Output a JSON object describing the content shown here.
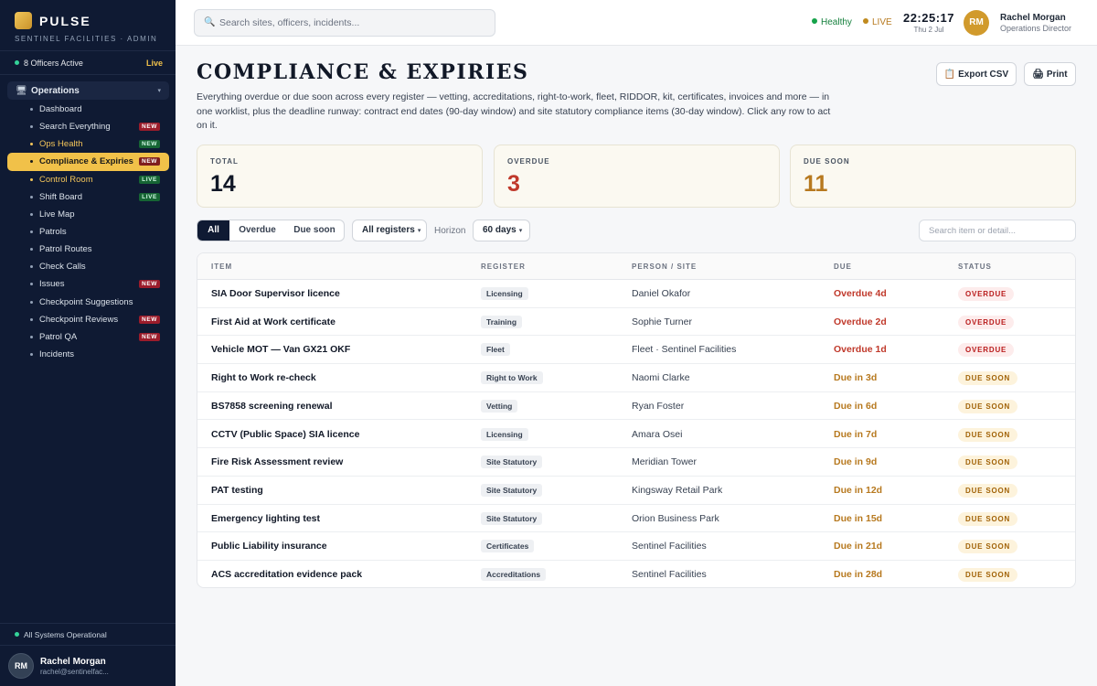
{
  "sidebar": {
    "brand_name": "PULSE",
    "brand_sub": "SENTINEL FACILITIES · ADMIN",
    "officers_active": "8 Officers Active",
    "live_label": "Live",
    "group_label": "Operations",
    "items": [
      {
        "label": "Dashboard",
        "badge": "",
        "badge_type": "",
        "state": ""
      },
      {
        "label": "Search Everything",
        "badge": "NEW",
        "badge_type": "new",
        "state": ""
      },
      {
        "label": "Ops Health",
        "badge": "NEW",
        "badge_type": "live",
        "state": "gold"
      },
      {
        "label": "Compliance & Expiries",
        "badge": "NEW",
        "badge_type": "new",
        "state": "active"
      },
      {
        "label": "Control Room",
        "badge": "LIVE",
        "badge_type": "live",
        "state": "gold"
      },
      {
        "label": "Shift Board",
        "badge": "LIVE",
        "badge_type": "live",
        "state": ""
      },
      {
        "label": "Live Map",
        "badge": "",
        "badge_type": "",
        "state": ""
      },
      {
        "label": "Patrols",
        "badge": "",
        "badge_type": "",
        "state": ""
      },
      {
        "label": "Patrol Routes",
        "badge": "",
        "badge_type": "",
        "state": ""
      },
      {
        "label": "Check Calls",
        "badge": "",
        "badge_type": "",
        "state": ""
      },
      {
        "label": "Issues",
        "badge": "NEW",
        "badge_type": "new",
        "state": ""
      },
      {
        "label": "Checkpoint Suggestions",
        "badge": "",
        "badge_type": "",
        "state": ""
      },
      {
        "label": "Checkpoint Reviews",
        "badge": "NEW",
        "badge_type": "new",
        "state": ""
      },
      {
        "label": "Patrol QA",
        "badge": "NEW",
        "badge_type": "new",
        "state": ""
      },
      {
        "label": "Incidents",
        "badge": "",
        "badge_type": "",
        "state": ""
      }
    ],
    "system_status": "All Systems Operational",
    "user": {
      "initials": "RM",
      "name": "Rachel Morgan",
      "email": "rachel@sentinelfac..."
    }
  },
  "topbar": {
    "search_placeholder": "Search sites, officers, incidents...",
    "health_label": "Healthy",
    "live_label": "LIVE",
    "time": "22:25:17",
    "date": "Thu 2 Jul",
    "user_initials": "RM",
    "user_name": "Rachel Morgan",
    "user_role": "Operations Director"
  },
  "page": {
    "title": "COMPLIANCE & EXPIRIES",
    "description": "Everything overdue or due soon across every register — vetting, accreditations, right-to-work, fleet, RIDDOR, kit, certificates, invoices and more — in one worklist, plus the deadline runway: contract end dates (90-day window) and site statutory compliance items (30-day window). Click any row to act on it.",
    "export_label": "Export CSV",
    "print_label": "Print"
  },
  "stats": {
    "total_label": "TOTAL",
    "total_value": "14",
    "overdue_label": "OVERDUE",
    "overdue_value": "3",
    "duesoon_label": "DUE SOON",
    "duesoon_value": "11"
  },
  "filters": {
    "segment": [
      "All",
      "Overdue",
      "Due soon"
    ],
    "registers_label": "All registers",
    "horizon_label": "Horizon",
    "horizon_value": "60 days",
    "search_placeholder": "Search item or detail..."
  },
  "table": {
    "columns": [
      "ITEM",
      "REGISTER",
      "PERSON / SITE",
      "DUE",
      "STATUS"
    ],
    "rows": [
      {
        "item": "SIA Door Supervisor licence",
        "register": "Licensing",
        "person": "Daniel Okafor",
        "due": "Overdue 4d",
        "status": "OVERDUE",
        "kind": "overdue"
      },
      {
        "item": "First Aid at Work certificate",
        "register": "Training",
        "person": "Sophie Turner",
        "due": "Overdue 2d",
        "status": "OVERDUE",
        "kind": "overdue"
      },
      {
        "item": "Vehicle MOT — Van GX21 OKF",
        "register": "Fleet",
        "person": "Fleet · Sentinel Facilities",
        "due": "Overdue 1d",
        "status": "OVERDUE",
        "kind": "overdue"
      },
      {
        "item": "Right to Work re-check",
        "register": "Right to Work",
        "person": "Naomi Clarke",
        "due": "Due in 3d",
        "status": "DUE SOON",
        "kind": "soon"
      },
      {
        "item": "BS7858 screening renewal",
        "register": "Vetting",
        "person": "Ryan Foster",
        "due": "Due in 6d",
        "status": "DUE SOON",
        "kind": "soon"
      },
      {
        "item": "CCTV (Public Space) SIA licence",
        "register": "Licensing",
        "person": "Amara Osei",
        "due": "Due in 7d",
        "status": "DUE SOON",
        "kind": "soon"
      },
      {
        "item": "Fire Risk Assessment review",
        "register": "Site Statutory",
        "person": "Meridian Tower",
        "due": "Due in 9d",
        "status": "DUE SOON",
        "kind": "soon"
      },
      {
        "item": "PAT testing",
        "register": "Site Statutory",
        "person": "Kingsway Retail Park",
        "due": "Due in 12d",
        "status": "DUE SOON",
        "kind": "soon"
      },
      {
        "item": "Emergency lighting test",
        "register": "Site Statutory",
        "person": "Orion Business Park",
        "due": "Due in 15d",
        "status": "DUE SOON",
        "kind": "soon"
      },
      {
        "item": "Public Liability insurance",
        "register": "Certificates",
        "person": "Sentinel Facilities",
        "due": "Due in 21d",
        "status": "DUE SOON",
        "kind": "soon"
      },
      {
        "item": "ACS accreditation evidence pack",
        "register": "Accreditations",
        "person": "Sentinel Facilities",
        "due": "Due in 28d",
        "status": "DUE SOON",
        "kind": "soon"
      }
    ]
  }
}
